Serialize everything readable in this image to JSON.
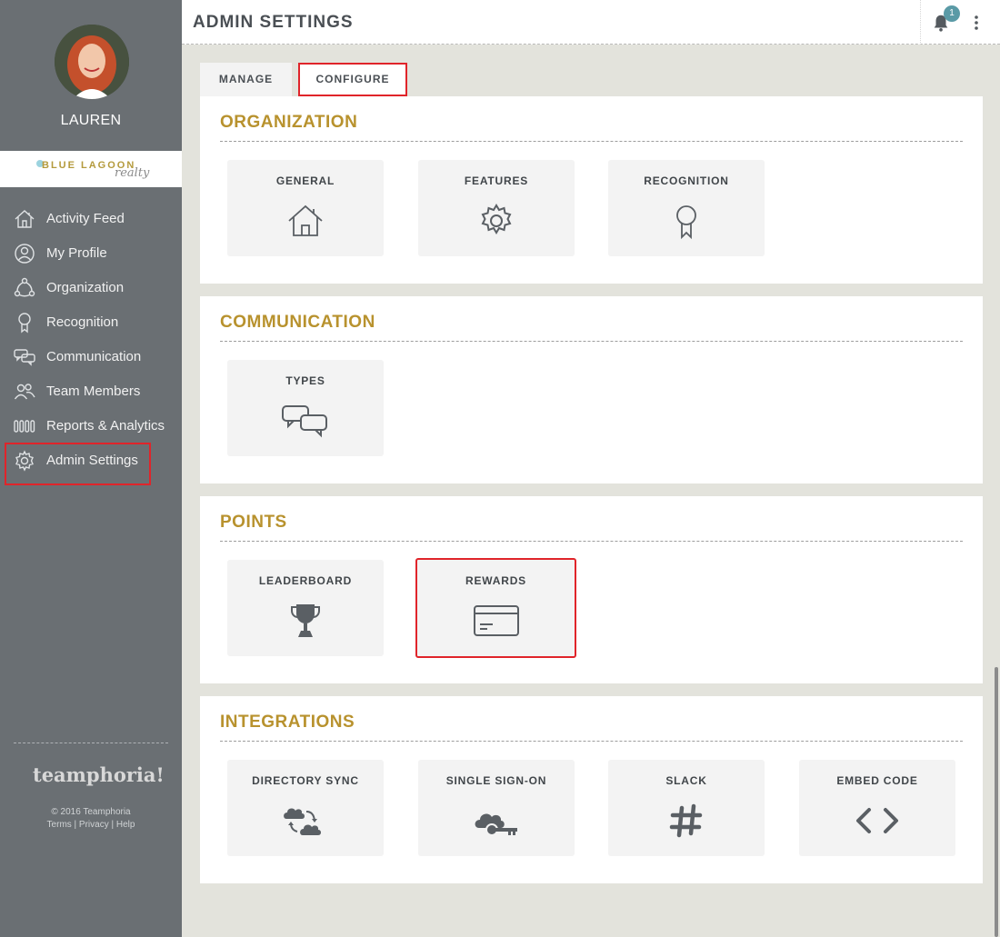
{
  "sidebar": {
    "user_name": "LAUREN",
    "brand_main": "BLUE LAGOON",
    "brand_sub": "realty",
    "nav": [
      {
        "label": "Activity Feed",
        "icon": "home-icon"
      },
      {
        "label": "My Profile",
        "icon": "profile-icon"
      },
      {
        "label": "Organization",
        "icon": "organization-icon"
      },
      {
        "label": "Recognition",
        "icon": "ribbon-icon"
      },
      {
        "label": "Communication",
        "icon": "chat-icon"
      },
      {
        "label": "Team Members",
        "icon": "team-icon"
      },
      {
        "label": "Reports & Analytics",
        "icon": "bars-icon"
      },
      {
        "label": "Admin Settings",
        "icon": "gear-icon"
      }
    ],
    "footer_logo": "teamphoria!",
    "footer_copyright": "© 2016 Teamphoria",
    "footer_links": "Terms | Privacy | Help"
  },
  "header": {
    "title": "ADMIN SETTINGS",
    "notification_count": "1"
  },
  "tabs": [
    {
      "label": "MANAGE"
    },
    {
      "label": "CONFIGURE"
    }
  ],
  "sections": [
    {
      "title": "ORGANIZATION",
      "cards": [
        {
          "label": "GENERAL",
          "icon": "house-icon"
        },
        {
          "label": "FEATURES",
          "icon": "gear-icon"
        },
        {
          "label": "RECOGNITION",
          "icon": "ribbon-icon"
        }
      ]
    },
    {
      "title": "COMMUNICATION",
      "cards": [
        {
          "label": "TYPES",
          "icon": "chat-bubbles-icon"
        }
      ]
    },
    {
      "title": "POINTS",
      "cards": [
        {
          "label": "LEADERBOARD",
          "icon": "trophy-icon"
        },
        {
          "label": "REWARDS",
          "icon": "credit-card-icon"
        }
      ]
    },
    {
      "title": "INTEGRATIONS",
      "cards": [
        {
          "label": "DIRECTORY SYNC",
          "icon": "cloud-sync-icon"
        },
        {
          "label": "SINGLE SIGN-ON",
          "icon": "cloud-key-icon"
        },
        {
          "label": "SLACK",
          "icon": "hashtag-icon"
        },
        {
          "label": "EMBED CODE",
          "icon": "code-icon"
        }
      ]
    }
  ],
  "colors": {
    "sidebar_bg": "#6a6f73",
    "accent_gold": "#b8922e",
    "highlight_red": "#e0242a",
    "badge": "#5a9aa6"
  }
}
